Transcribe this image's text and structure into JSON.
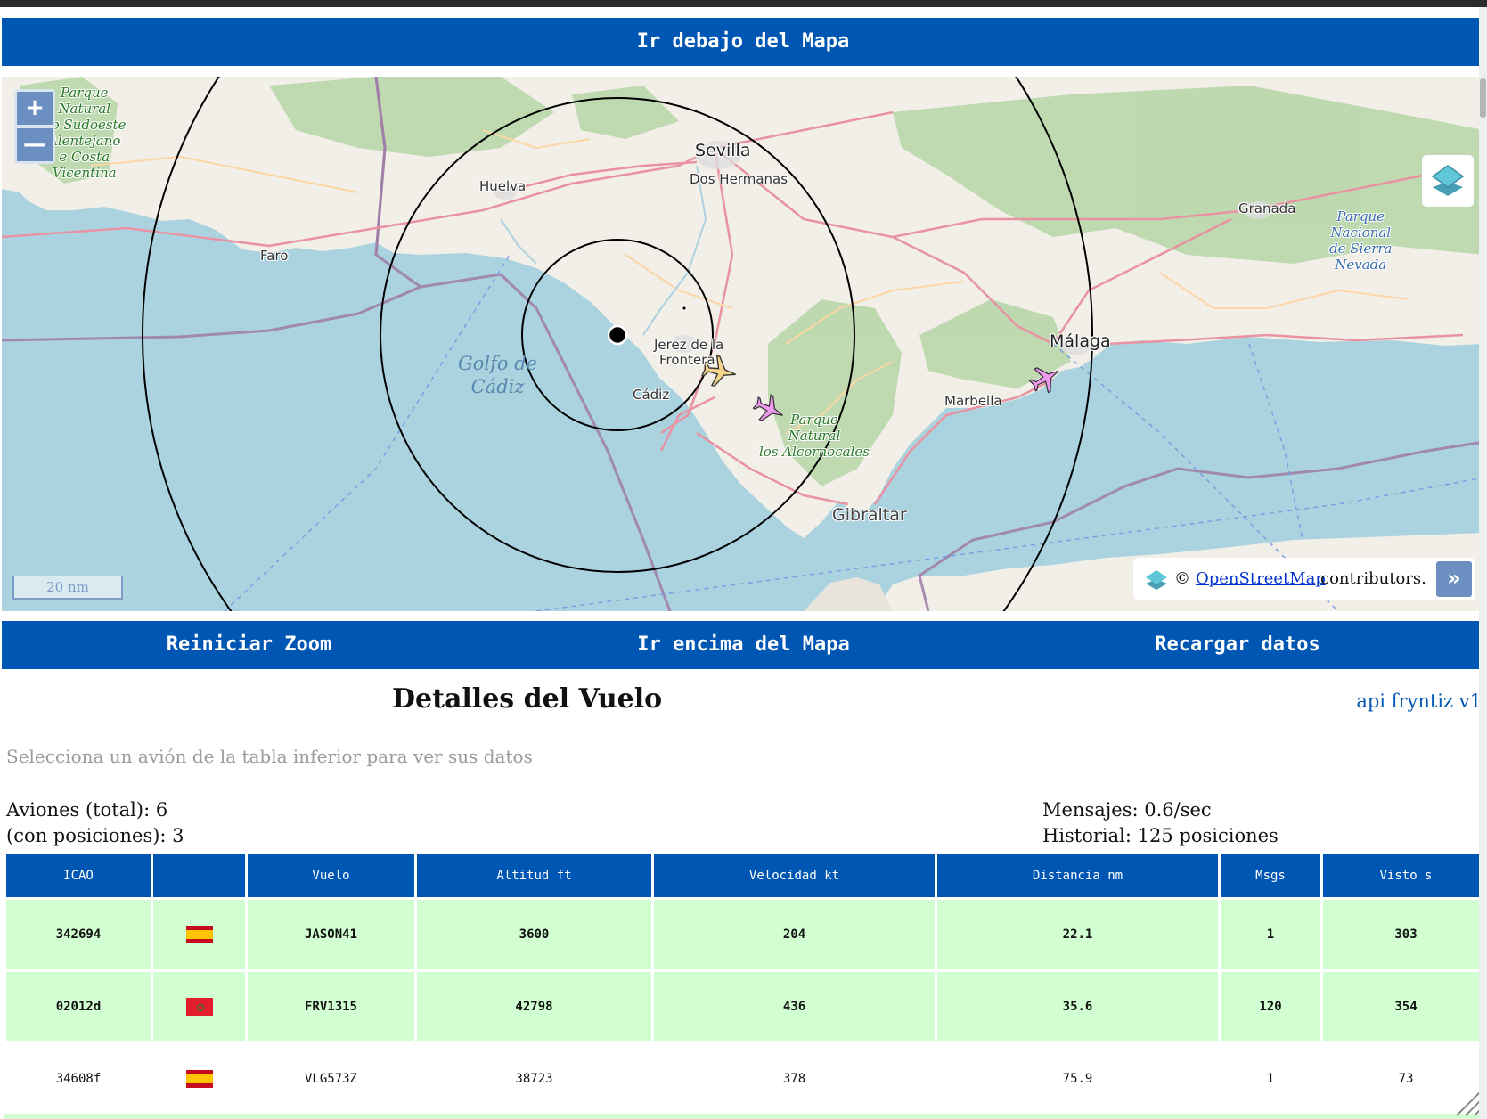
{
  "nav": {
    "below_map": "Ir debajo del Mapa",
    "reset_zoom": "Reiniciar Zoom",
    "above_map": "Ir encima del Mapa",
    "reload": "Recargar datos"
  },
  "map": {
    "zoom_in": "+",
    "zoom_out": "—",
    "scale": "20 nm",
    "attribution": {
      "copyright": "©",
      "link": "OpenStreetMap",
      "suffix": "contributors.",
      "expand": "»"
    },
    "labels": {
      "sevilla": "Sevilla",
      "dos_hermanas": "Dos Hermanas",
      "huelva": "Huelva",
      "faro": "Faro",
      "granada": "Granada",
      "malaga": "Málaga",
      "marbella": "Marbella",
      "cadiz": "Cádiz",
      "jerez_1": "Jerez de la",
      "jerez_2": "Frontera",
      "gibraltar": "Gibraltar",
      "golfo_1": "Golfo de",
      "golfo_2": "Cádiz",
      "park_sw_1": "Parque",
      "park_sw_2": "Natural",
      "park_sw_3": "do Sudoeste",
      "park_sw_4": "Alentejano",
      "park_sw_5": "e Costa",
      "park_sw_6": "Vicentina",
      "park_alc_1": "Parque",
      "park_alc_2": "Natural",
      "park_alc_3": "los Alcornocales",
      "park_ne_1": "Parque",
      "park_ne_2": "Nacional",
      "park_ne_3": "de Sierra",
      "park_ne_4": "Nevada"
    }
  },
  "details": {
    "title": "Detalles del Vuelo",
    "api_link": "api fryntiz v1",
    "hint": "Selecciona un avión de la tabla inferior para ver sus datos"
  },
  "stats": {
    "total": "Aviones (total): 6",
    "with_pos": "(con posiciones): 3",
    "messages": "Mensajes: 0.6/sec",
    "history": "Historial: 125 posiciones"
  },
  "table": {
    "headers": {
      "icao": "ICAO",
      "flag": "",
      "flight": "Vuelo",
      "altitude": "Altitud ft",
      "speed": "Velocidad kt",
      "distance": "Distancia nm",
      "msgs": "Msgs",
      "seen": "Visto s"
    },
    "rows": [
      {
        "icao": "342694",
        "country": "es",
        "flight": "JASON41",
        "altitude": "3600",
        "speed": "204",
        "distance": "22.1",
        "msgs": "1",
        "seen": "303"
      },
      {
        "icao": "02012d",
        "country": "ma",
        "flight": "FRV1315",
        "altitude": "42798",
        "speed": "436",
        "distance": "35.6",
        "msgs": "120",
        "seen": "354"
      },
      {
        "icao": "34608f",
        "country": "es",
        "flight": "VLG573Z",
        "altitude": "38723",
        "speed": "378",
        "distance": "75.9",
        "msgs": "1",
        "seen": "73"
      }
    ]
  },
  "colors": {
    "bar": "#0057b3",
    "sea": "#aad3df",
    "land": "#f2efe9",
    "row_highlight": "#d1ffd1",
    "plane_yellow": "#f4d58a",
    "plane_pink": "#ee99ee"
  },
  "icons": {
    "layers": "layers-icon",
    "plane": "airplane-icon",
    "receiver": "receiver-dot-icon"
  }
}
